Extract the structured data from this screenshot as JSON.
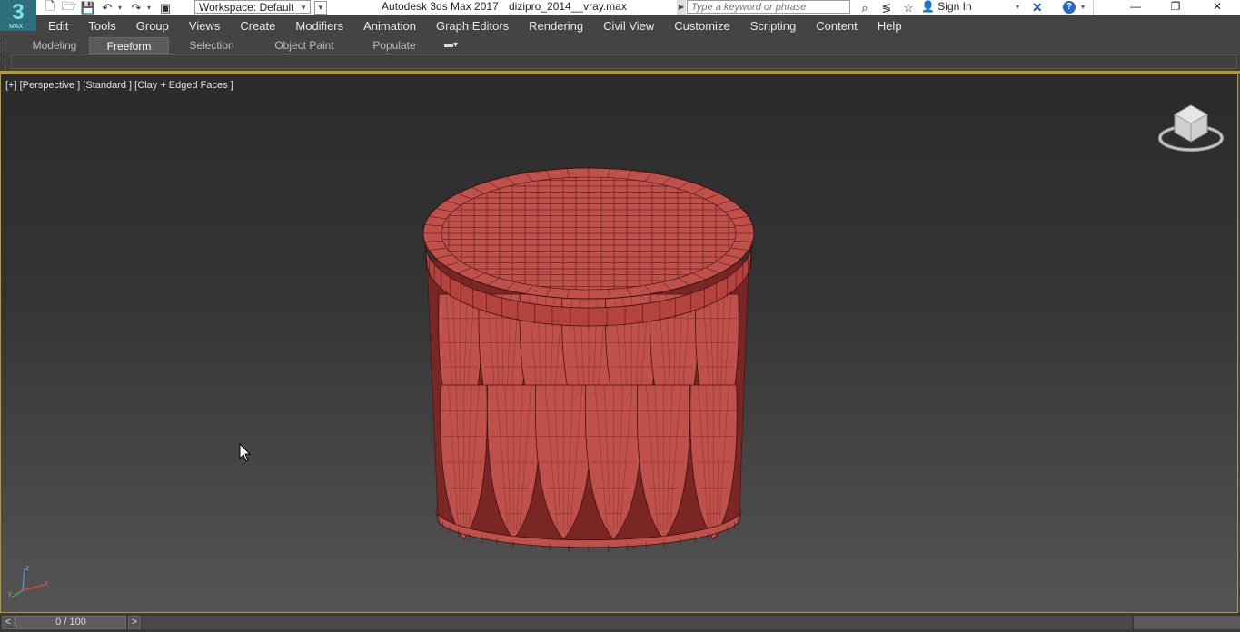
{
  "titlebar": {
    "workspace_label": "Workspace: Default",
    "app_title": "Autodesk 3ds Max 2017",
    "file_name": "dizipro_2014__vray.max",
    "search_placeholder": "Type a keyword or phrase",
    "sign_in": "Sign In",
    "logo_text": "3",
    "logo_sub": "MAX"
  },
  "menu": {
    "items": [
      "Edit",
      "Tools",
      "Group",
      "Views",
      "Create",
      "Modifiers",
      "Animation",
      "Graph Editors",
      "Rendering",
      "Civil View",
      "Customize",
      "Scripting",
      "Content",
      "Help"
    ]
  },
  "ribbon": {
    "tabs": [
      "Modeling",
      "Freeform",
      "Selection",
      "Object Paint",
      "Populate"
    ],
    "active_tab": "Freeform"
  },
  "viewport": {
    "label": "[+] [Perspective ] [Standard ] [Clay + Edged Faces ]",
    "mesh_color": "#c0504a",
    "wire_color": "#3a1212"
  },
  "timeline": {
    "frame_readout": "0 / 100",
    "prev_label": "<",
    "next_label": ">"
  },
  "colors": {
    "accent_border": "#b49b2c"
  }
}
